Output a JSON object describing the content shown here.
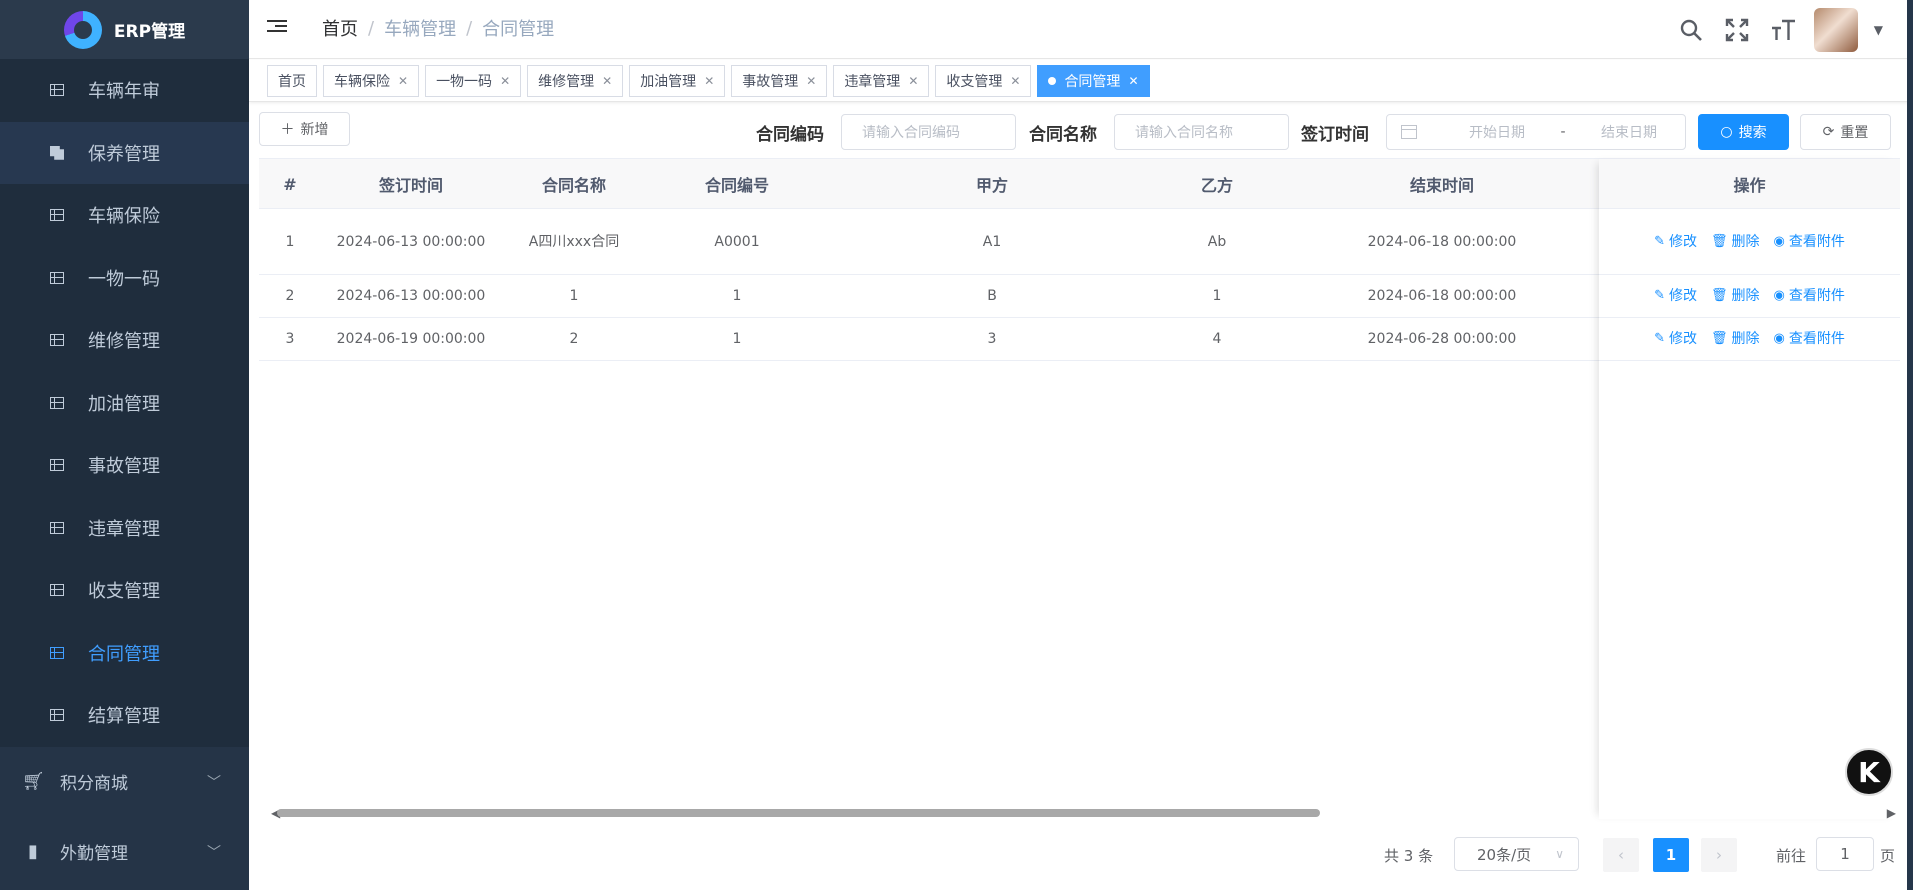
{
  "app": {
    "title": "ERP管理"
  },
  "sidebar": {
    "items": [
      {
        "label": "车辆年审"
      },
      {
        "label": "保养管理"
      },
      {
        "label": "车辆保险"
      },
      {
        "label": "一物一码"
      },
      {
        "label": "维修管理"
      },
      {
        "label": "加油管理"
      },
      {
        "label": "事故管理"
      },
      {
        "label": "违章管理"
      },
      {
        "label": "收支管理"
      },
      {
        "label": "合同管理",
        "active": true
      },
      {
        "label": "结算管理"
      }
    ],
    "groups": [
      {
        "label": "积分商城",
        "icon": "cart-icon"
      },
      {
        "label": "外勤管理",
        "icon": "bar-chart-icon"
      }
    ]
  },
  "header": {
    "breadcrumb": [
      "首页",
      "车辆管理",
      "合同管理"
    ],
    "separator": "/"
  },
  "tags": [
    "首页",
    "车辆保险",
    "一物一码",
    "维修管理",
    "加油管理",
    "事故管理",
    "违章管理",
    "收支管理",
    "合同管理"
  ],
  "toolbar": {
    "add_label": "新增",
    "contract_code_label": "合同编码",
    "contract_code_placeholder": "请输入合同编码",
    "contract_name_label": "合同名称",
    "contract_name_placeholder": "请输入合同名称",
    "sign_time_label": "签订时间",
    "start_placeholder": "开始日期",
    "range_sep": "-",
    "end_placeholder": "结束日期",
    "search_label": "搜索",
    "reset_label": "重置"
  },
  "table": {
    "headers": [
      "#",
      "签订时间",
      "合同名称",
      "合同编号",
      "甲方",
      "乙方",
      "结束时间",
      "操作"
    ],
    "rows": [
      {
        "idx": "1",
        "sign": "2024-06-13 00:00:00",
        "name": "A四川xxx合同",
        "no": "A0001",
        "a": "A1",
        "b": "Ab",
        "end": "2024-06-18 00:00:00"
      },
      {
        "idx": "2",
        "sign": "2024-06-13 00:00:00",
        "name": "1",
        "no": "1",
        "a": "B",
        "b": "1",
        "end": "2024-06-18 00:00:00"
      },
      {
        "idx": "3",
        "sign": "2024-06-19 00:00:00",
        "name": "2",
        "no": "1",
        "a": "3",
        "b": "4",
        "end": "2024-06-28 00:00:00"
      }
    ],
    "actions": {
      "edit": "修改",
      "delete": "删除",
      "attach": "查看附件"
    }
  },
  "pagination": {
    "total": "共 3 条",
    "page_size": "20条/页",
    "current": "1",
    "goto": "前往",
    "goto_value": "1",
    "page": "页"
  },
  "badge": {
    "letter": "K"
  },
  "colors": {
    "primary": "#1890ff",
    "sidebar": "#253447",
    "active": "#409eff"
  }
}
